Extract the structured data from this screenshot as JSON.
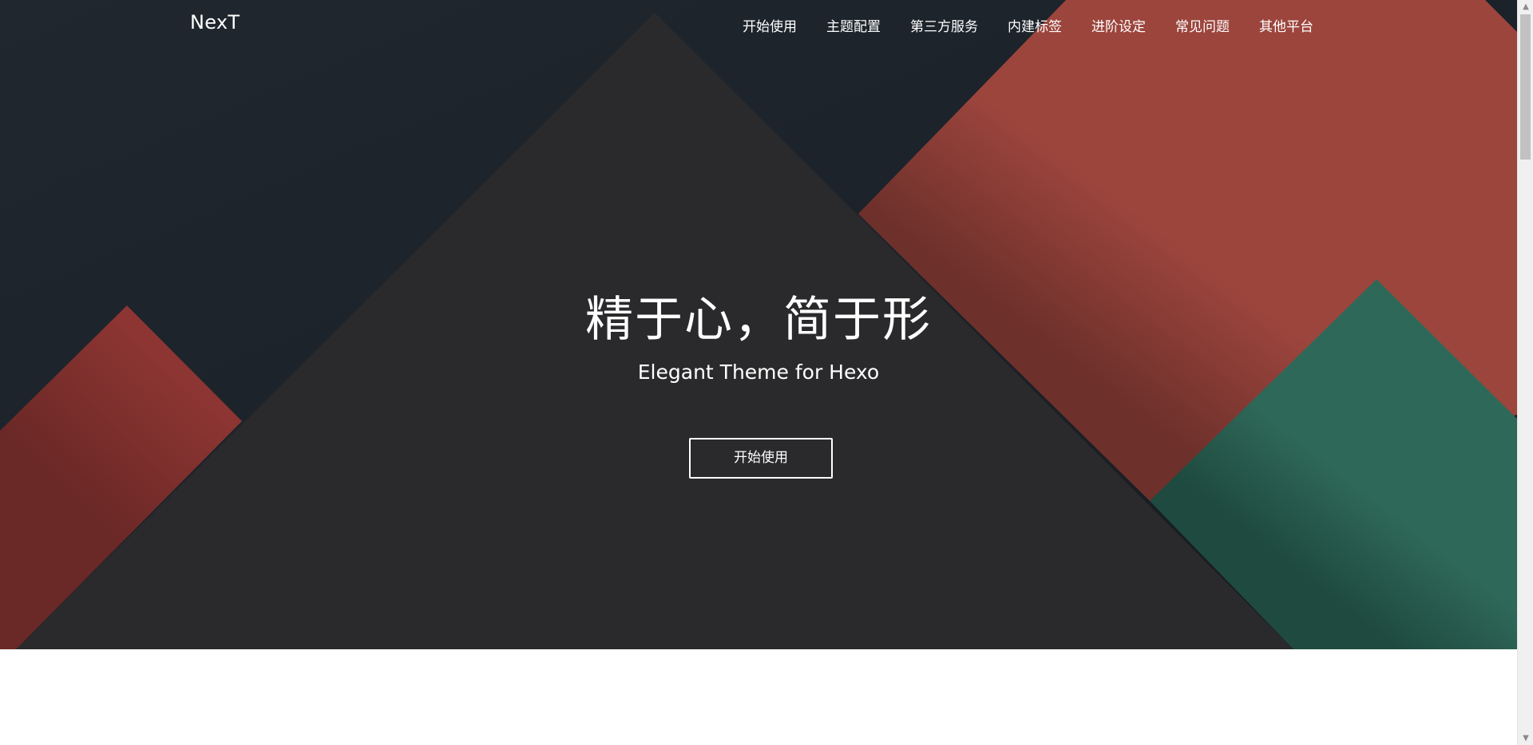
{
  "brand": {
    "name": "NexT"
  },
  "nav": {
    "items": [
      {
        "label": "开始使用"
      },
      {
        "label": "主题配置"
      },
      {
        "label": "第三方服务"
      },
      {
        "label": "内建标签"
      },
      {
        "label": "进阶设定"
      },
      {
        "label": "常见问题"
      },
      {
        "label": "其他平台"
      }
    ]
  },
  "hero": {
    "title": "精于心，简于形",
    "subtitle": "Elegant Theme for Hexo",
    "button_label": "开始使用"
  },
  "colors": {
    "background_dark": "#1f262e",
    "triangle_dark": "#2a2a2c",
    "red": "#9c453d",
    "red_left": "#8c3532",
    "green": "#2e6858",
    "text": "#ffffff"
  },
  "scrollbar": {
    "up_icon": "chevron-up-icon",
    "down_icon": "chevron-down-icon"
  }
}
